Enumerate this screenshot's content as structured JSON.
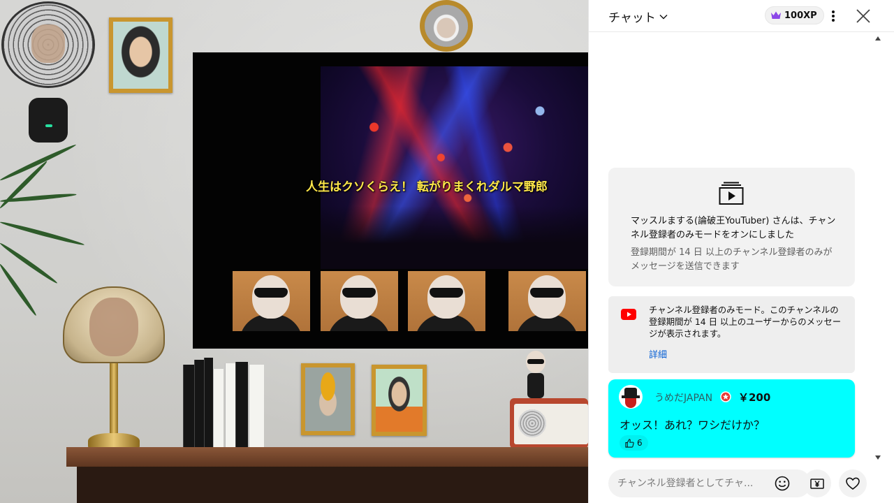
{
  "video": {
    "caption": "人生はクソくらえ！ 転がりまくれダルマ野郎"
  },
  "chat": {
    "title": "チャット",
    "xp": "100XP",
    "notice": {
      "main": "マッスルまする(論破王YouTuber) さんは、チャンネル登録者のみモードをオンにしました",
      "sub": "登録期間が 14 日 以上のチャンネル登録者のみがメッセージを送信できます"
    },
    "members_mode": {
      "text": "チャンネル登録者のみモード。このチャンネルの登録期間が 14 日 以上のユーザーからのメッセージが表示されます。",
      "link": "詳細"
    },
    "superchat": {
      "author": "うめだJAPAN",
      "amount": "￥200",
      "message": "オッス！あれ？ワシだけか？",
      "likes": "6",
      "bg_color": "#00ffff"
    },
    "input": {
      "placeholder": "チャンネル登録者としてチャ..."
    },
    "icons": [
      "chevron-down-icon",
      "crown-icon",
      "kebab-icon",
      "close-icon",
      "video-card-icon",
      "youtube-icon",
      "verified-icon",
      "thumbs-up-icon",
      "emoji-icon",
      "yen-icon",
      "heart-icon"
    ]
  }
}
